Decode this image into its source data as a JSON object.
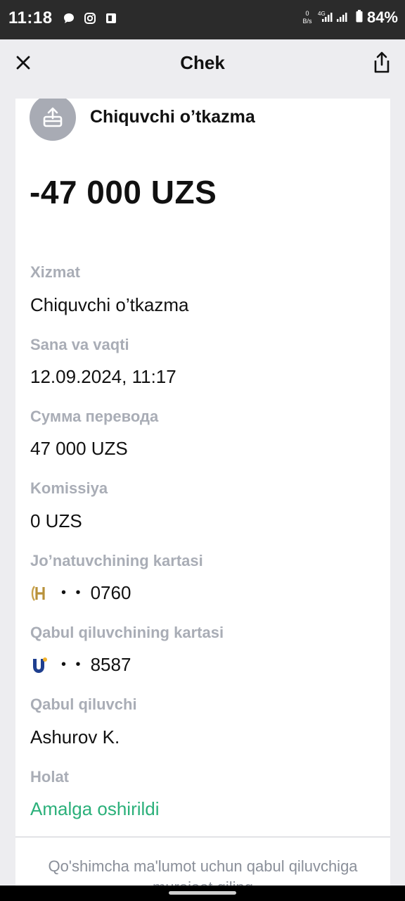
{
  "status_bar": {
    "time": "11:18",
    "net_speed_value": "0",
    "net_speed_unit": "B/s",
    "network": "4G",
    "battery": "84%",
    "left_icons": [
      "chat-bubble-icon",
      "instagram-icon",
      "office-icon"
    ]
  },
  "header": {
    "title": "Chek"
  },
  "transaction": {
    "type": "Chiquvchi o’tkazma",
    "amount": "-47 000 UZS"
  },
  "fields": [
    {
      "label": "Xizmat",
      "value": "Chiquvchi o’tkazma"
    },
    {
      "label": "Sana va vaqti",
      "value": "12.09.2024, 11:17"
    },
    {
      "label": "Сумма перевода",
      "value": "47 000 UZS"
    },
    {
      "label": "Komissiya",
      "value": "0 UZS"
    },
    {
      "label": "Jo’natuvchining kartasi",
      "dots": "• •",
      "value": "0760",
      "icon": "humo-logo-icon"
    },
    {
      "label": "Qabul qiluvchining kartasi",
      "dots": "• •",
      "value": "8587",
      "icon": "uzcard-logo-icon"
    },
    {
      "label": "Qabul qiluvchi",
      "value": "Ashurov K."
    },
    {
      "label": "Holat",
      "value": "Amalga oshirildi"
    }
  ],
  "note": "Qo'shimcha ma'lumot uchun qabul qiluvchiga murojaat qiling",
  "colors": {
    "status_success": "#2bb07a",
    "label_gray": "#a9adb6",
    "icon_circle": "#a8abb4"
  }
}
